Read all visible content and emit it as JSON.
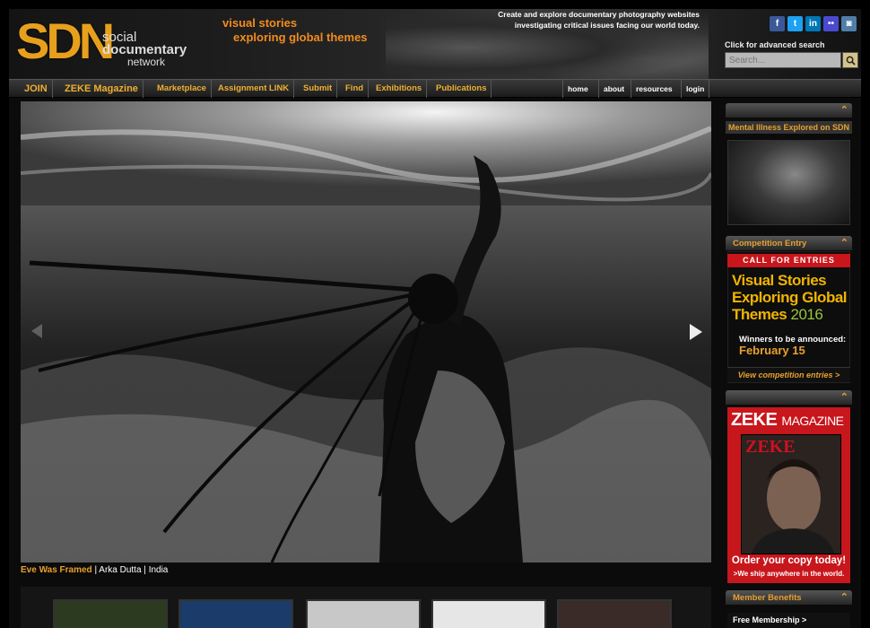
{
  "header": {
    "logo_sdn": "SDN",
    "logo_social": "social",
    "logo_documentary": "documentary",
    "logo_network": "network",
    "tagline_line1": "visual stories",
    "tagline_line2": "exploring global themes",
    "description_line1": "Create and explore documentary photography websites",
    "description_line2": "investigating critical issues facing our world today.",
    "social_icons": [
      {
        "name": "facebook-icon",
        "glyph": "f",
        "color": "#3b5998"
      },
      {
        "name": "twitter-icon",
        "glyph": "t",
        "color": "#1da1f2"
      },
      {
        "name": "linkedin-icon",
        "glyph": "in",
        "color": "#0077b5"
      },
      {
        "name": "flickr-icon",
        "glyph": "••",
        "color": "#4a4ad0"
      },
      {
        "name": "instagram-icon",
        "glyph": "◙",
        "color": "#4f7fa8"
      }
    ],
    "advanced_search": "Click for advanced search",
    "search_placeholder": "Search..."
  },
  "nav": {
    "items": [
      "JOIN",
      "ZEKE Magazine",
      "Marketplace",
      "Assignment LINK",
      "Submit",
      "Find",
      "Exhibitions",
      "Publications"
    ],
    "right_items": [
      "home",
      "about",
      "resources",
      "login"
    ]
  },
  "main": {
    "caption_title": "Eve Was Framed",
    "caption_sep1": " | ",
    "caption_author": "Arka Dutta",
    "caption_sep2": " | ",
    "caption_country": "India"
  },
  "sidebar": {
    "mental_illness_label": "Mental Illness Explored on SDN",
    "competition_header": "Competition Entry",
    "call_for_entries": "CALL FOR ENTRIES",
    "comp_title": "Visual Stories Exploring Global Themes",
    "comp_year": "2016",
    "comp_winners": "Winners to be announced:",
    "comp_date": "February 15",
    "comp_view": "View competition entries >",
    "zeke_title": "ZEKE",
    "zeke_magazine": "MAGAZINE",
    "zeke_cover_brand": "ZEKE",
    "zeke_order": "Order your copy today!",
    "zeke_ship": ">We ship anywhere in the world.",
    "member_header": "Member Benefits",
    "member_item": "Free Membership >"
  },
  "colors": {
    "accent": "#e8a030",
    "red": "#c7161c",
    "orange": "#f28c1e"
  }
}
